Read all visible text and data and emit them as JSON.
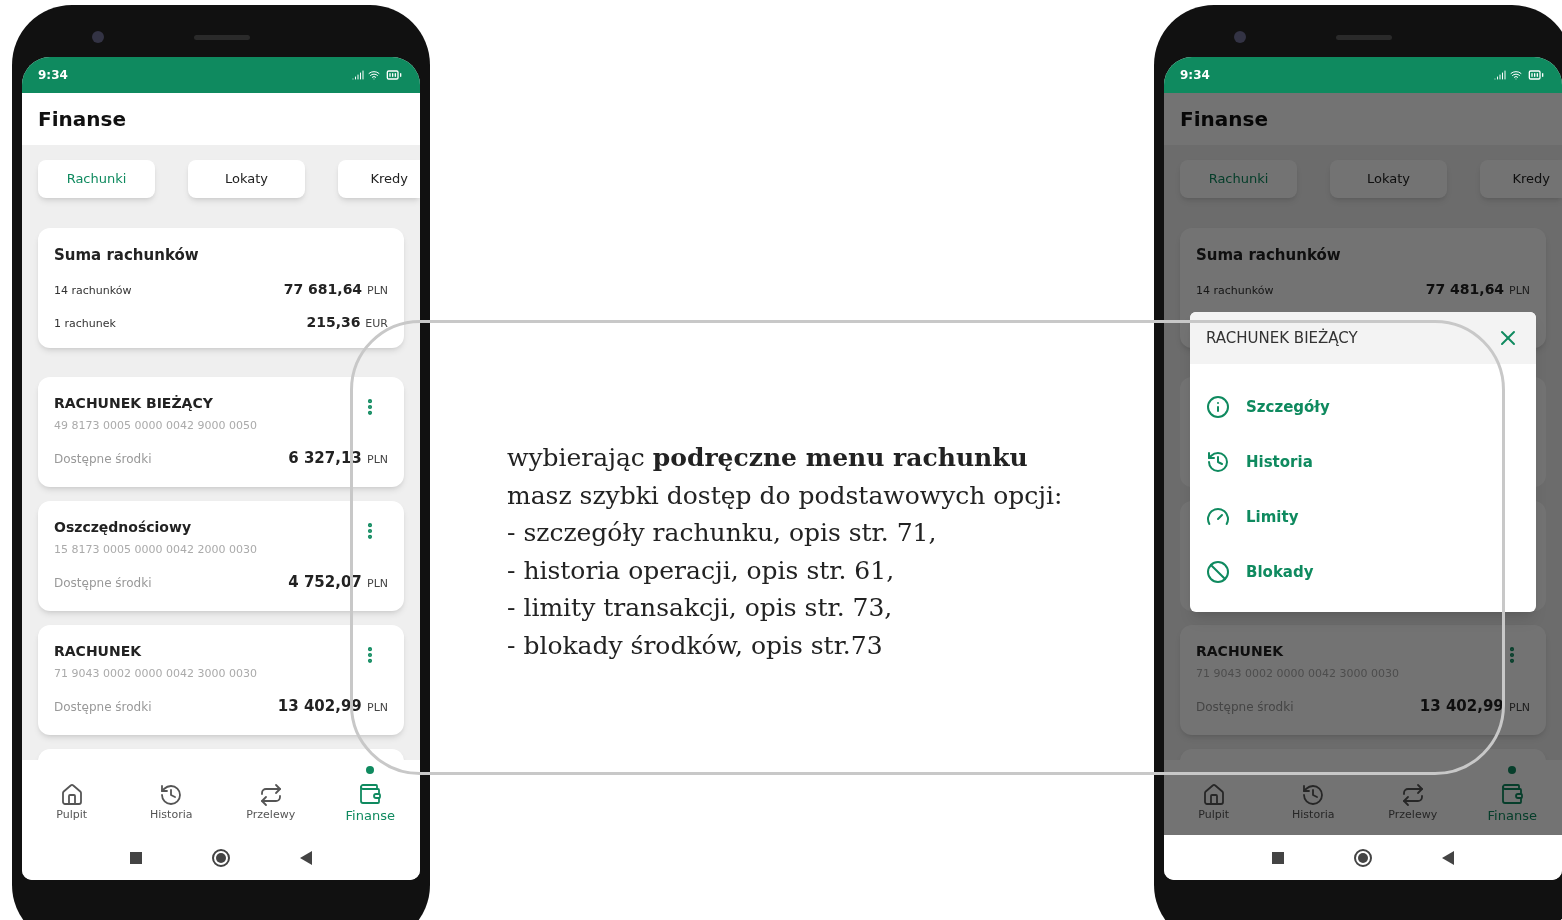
{
  "phones": [
    {
      "time": "9:34",
      "title": "Finanse",
      "tabs": [
        {
          "label": "Rachunki",
          "selected": true
        },
        {
          "label": "Lokaty",
          "selected": false
        },
        {
          "label": "Kredy",
          "selected": false
        }
      ],
      "summary": {
        "title": "Suma rachunków",
        "rows": [
          {
            "label": "14 rachunków",
            "amount": "77 681,64",
            "currency": "PLN"
          },
          {
            "label": "1 rachunek",
            "amount": "215,36",
            "currency": "EUR"
          }
        ]
      },
      "accounts": [
        {
          "name": "RACHUNEK BIEŻĄCY",
          "number": "49 8173 0005 0000 0042 9000 0050",
          "label": "Dostępne środki",
          "amount": "6 327,13",
          "currency": "PLN"
        },
        {
          "name": "Oszczędnościowy",
          "number": "15 8173 0005 0000 0042 2000 0030",
          "label": "Dostępne środki",
          "amount": "4 752,07",
          "currency": "PLN"
        },
        {
          "name": "RACHUNEK",
          "number": "71 9043 0002 0000 0042 3000 0030",
          "label": "Dostępne środki",
          "amount": "13 402,99",
          "currency": "PLN"
        }
      ],
      "nav": [
        {
          "kind": "home",
          "label": "Pulpit",
          "selected": false
        },
        {
          "kind": "history",
          "label": "Historia",
          "selected": false
        },
        {
          "kind": "transfer",
          "label": "Przelewy",
          "selected": false
        },
        {
          "kind": "wallet",
          "label": "Finanse",
          "selected": true
        }
      ]
    },
    {
      "time": "9:34",
      "title": "Finanse",
      "tabs": [
        {
          "label": "Rachunki",
          "selected": true
        },
        {
          "label": "Lokaty",
          "selected": false
        },
        {
          "label": "Kredy",
          "selected": false
        }
      ],
      "summary": {
        "title": "Suma rachunków",
        "rows": [
          {
            "label": "14 rachunków",
            "amount": "77 481,64",
            "currency": "PLN"
          }
        ]
      },
      "accounts": [
        {
          "name": "RACHUNEK",
          "number": "71 9043 0002 0000 0042 3000 0030",
          "label": "Dostępne środki",
          "amount": "13 402,99",
          "currency": "PLN"
        }
      ],
      "nav": [
        {
          "kind": "home",
          "label": "Pulpit",
          "selected": false
        },
        {
          "kind": "history",
          "label": "Historia",
          "selected": false
        },
        {
          "kind": "transfer",
          "label": "Przelewy",
          "selected": false
        },
        {
          "kind": "wallet",
          "label": "Finanse",
          "selected": true
        }
      ],
      "menu": {
        "title": "RACHUNEK BIEŻĄCY",
        "items": [
          {
            "kind": "info",
            "label": "Szczegóły"
          },
          {
            "kind": "history",
            "label": "Historia"
          },
          {
            "kind": "limits",
            "label": "Limity"
          },
          {
            "kind": "block",
            "label": "Blokady"
          }
        ]
      }
    }
  ],
  "description": {
    "lines": [
      "wybierając **podręczne menu rachunku**",
      "masz szybki dostęp do podstawowych opcji:",
      "- szczegóły rachunku, opis str. 71,",
      "- historia operacji, opis str. 61,",
      "- limity transakcji, opis str. 73,",
      "- blokady środków, opis str.73"
    ]
  }
}
